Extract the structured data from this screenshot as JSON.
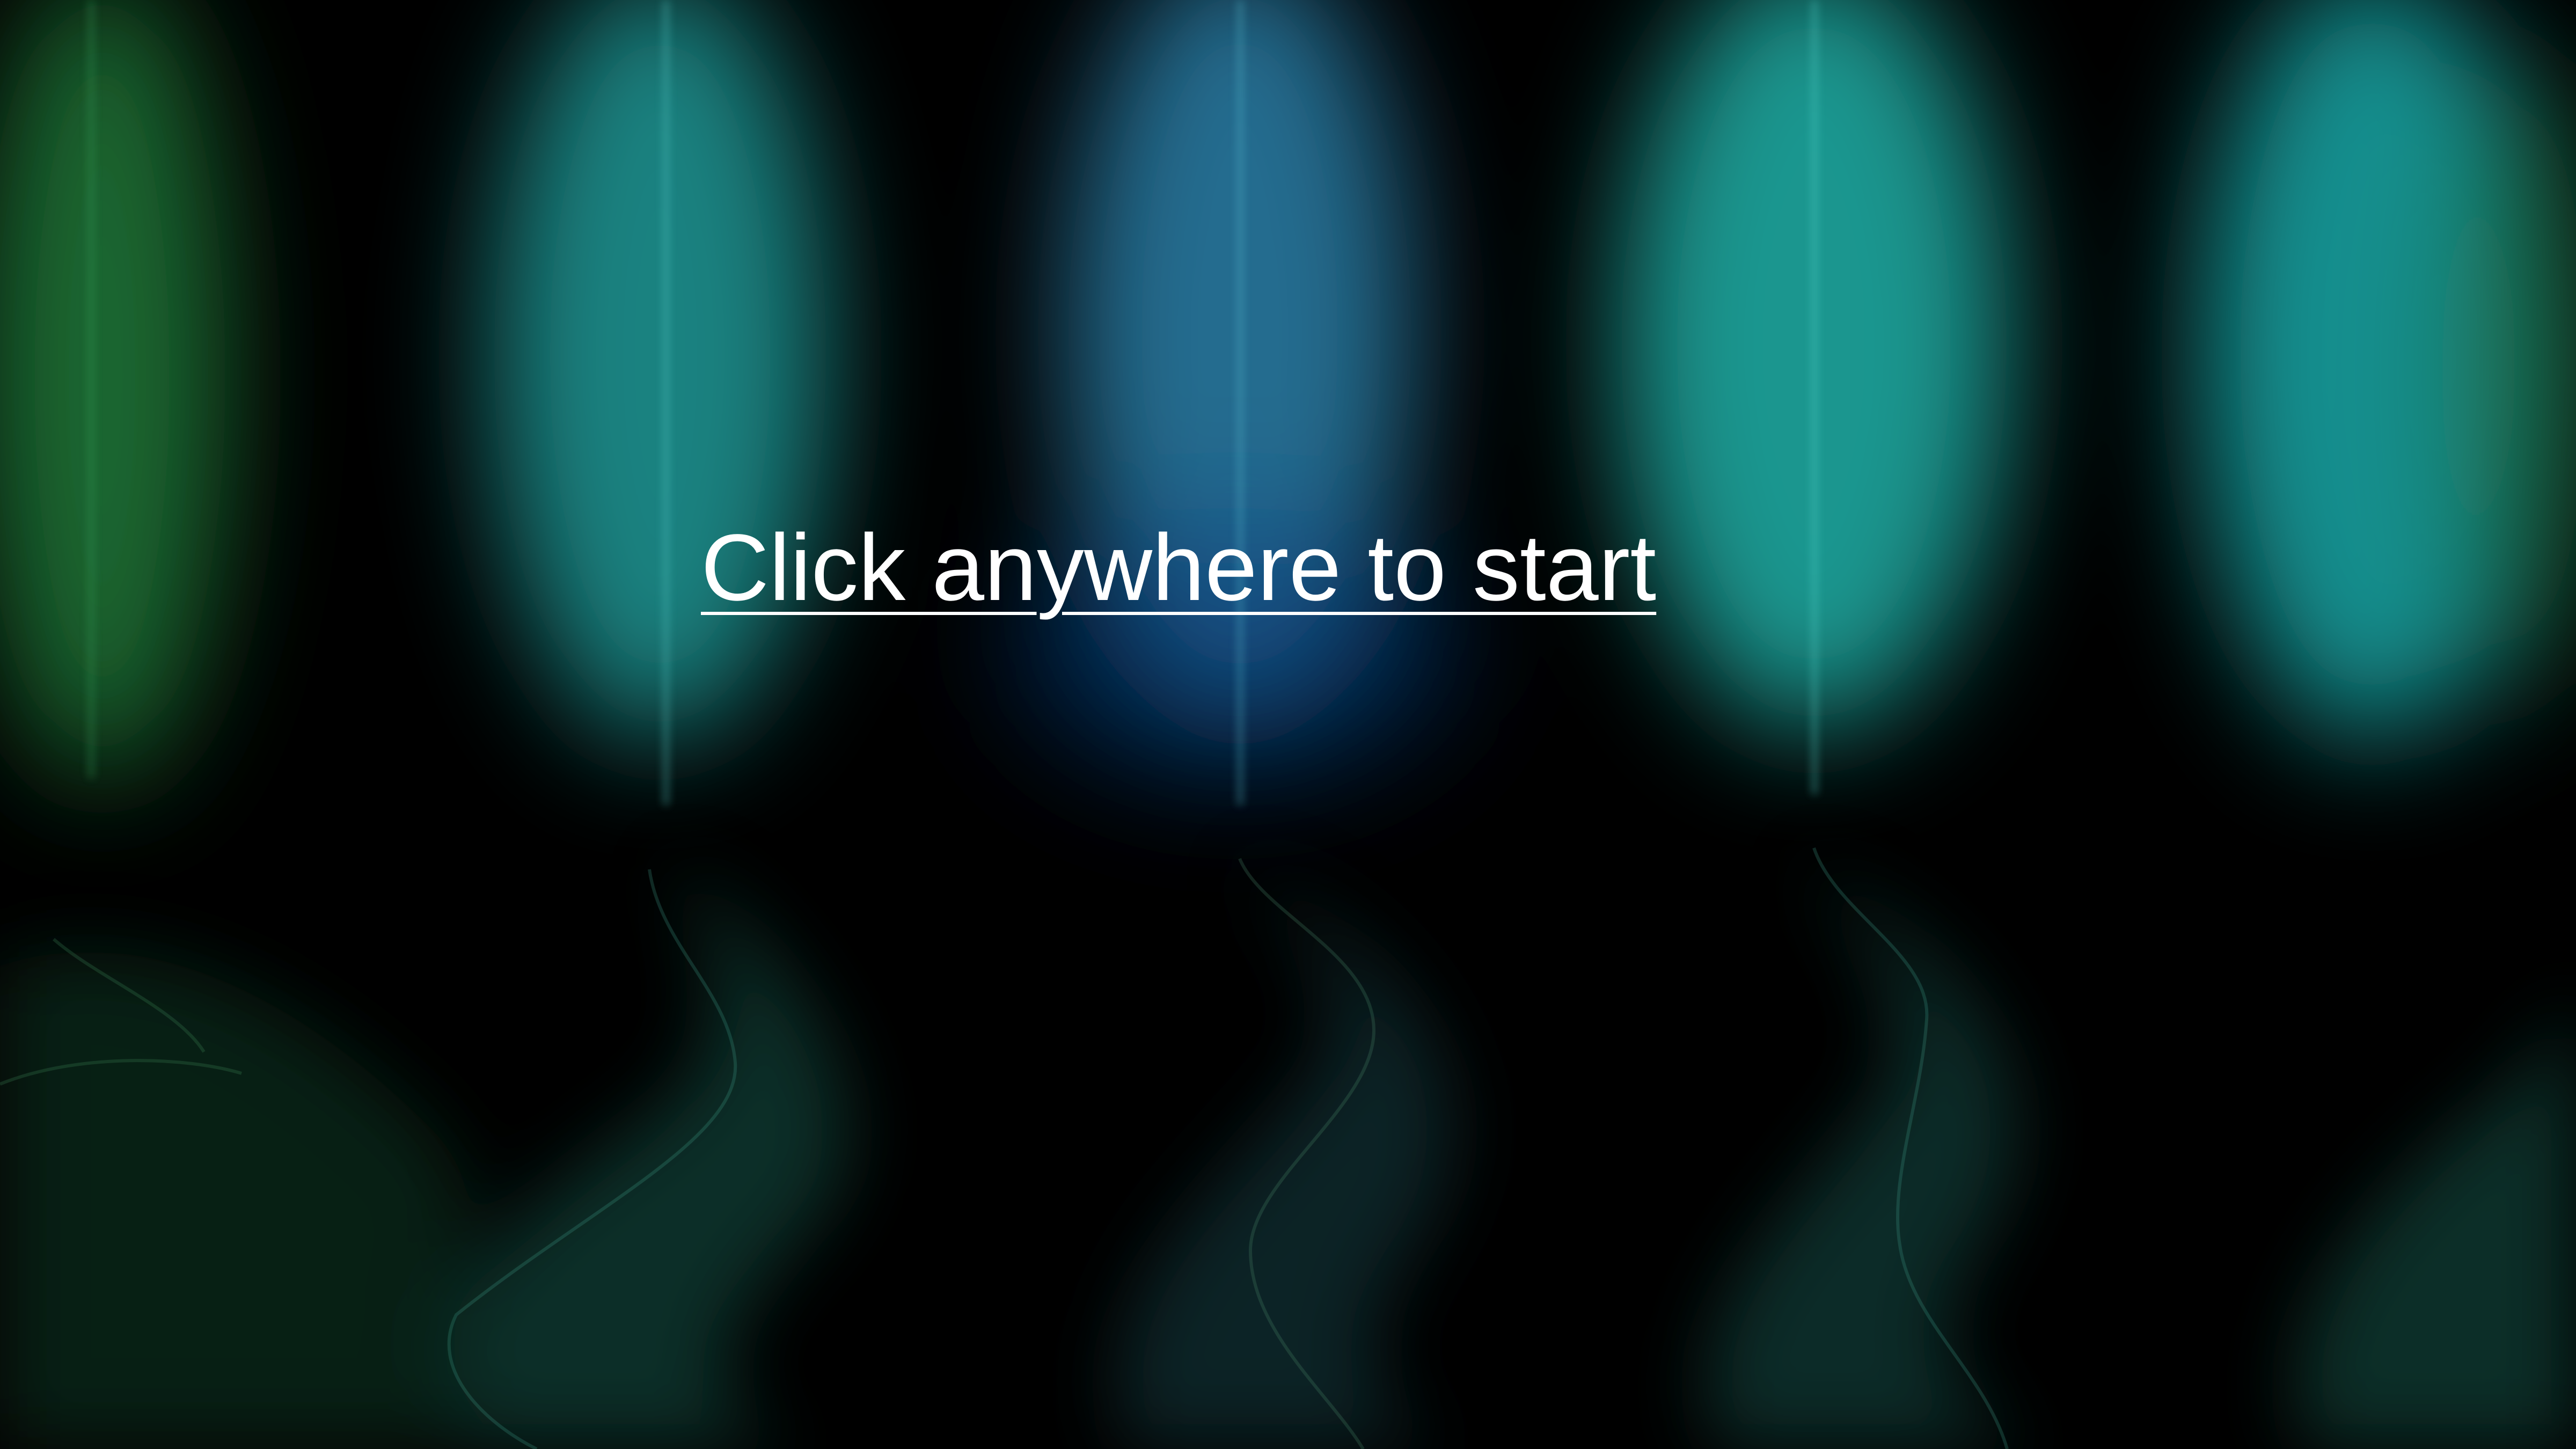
{
  "screen": {
    "start_prompt": "Click anywhere to start"
  },
  "background": {
    "description_colors": {
      "base": "#000000",
      "green": "#1f7a3a",
      "teal": "#1aa3a3",
      "blue": "#2a7fa8",
      "deep_blue": "#0b3a5c"
    }
  }
}
